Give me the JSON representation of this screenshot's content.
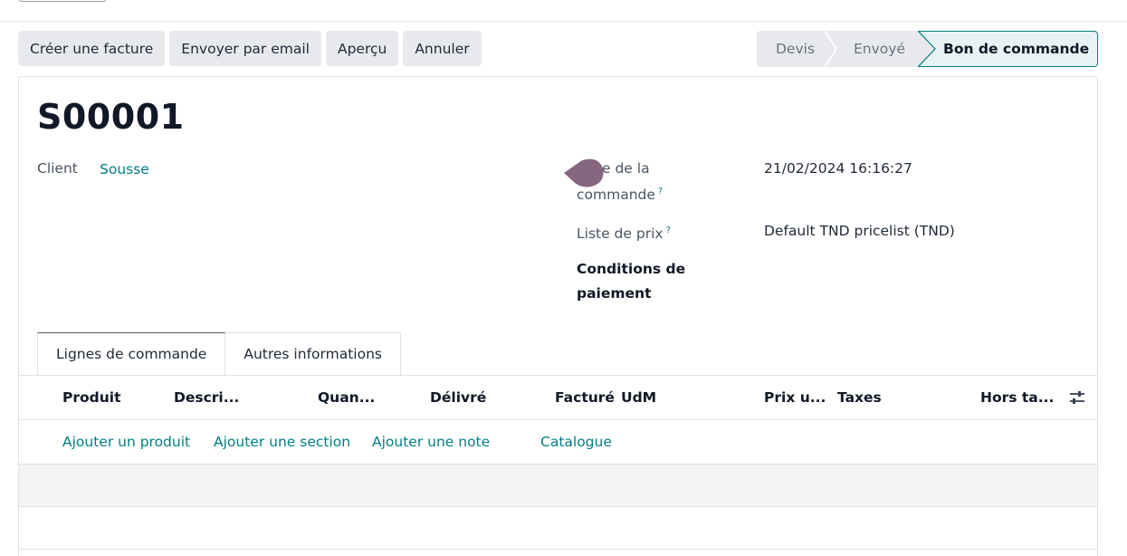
{
  "toolbar": {
    "create_invoice": "Créer une facture",
    "send_email": "Envoyer par email",
    "preview": "Aperçu",
    "cancel": "Annuler"
  },
  "statusbar": {
    "stages": [
      "Devis",
      "Envoyé",
      "Bon de commande"
    ],
    "active": "Bon de commande"
  },
  "record": {
    "name": "S00001",
    "client_label": "Client",
    "client_value": "Sousse",
    "order_date_label_line1": "e de la",
    "order_date_label_line2": "commande",
    "order_date_help": "?",
    "order_date_value": "21/02/2024 16:16:27",
    "pricelist_label": "Liste de prix",
    "pricelist_help": "?",
    "pricelist_value": "Default TND pricelist (TND)",
    "payment_terms_label_line1": "Conditions de",
    "payment_terms_label_line2": "paiement"
  },
  "tabs": {
    "order_lines": "Lignes de commande",
    "other_info": "Autres informations"
  },
  "table": {
    "columns": [
      "Produit",
      "Descri...",
      "Quan...",
      "Délivré",
      "Facturé",
      "UdM",
      "Prix u...",
      "Taxes",
      "Hors ta..."
    ]
  },
  "actions": {
    "add_product": "Ajouter un produit",
    "add_section": "Ajouter une section",
    "add_note": "Ajouter une note",
    "catalog": "Catalogue"
  },
  "colors": {
    "accent": "#017e84",
    "button_bg": "#e7e9ed",
    "cursor_blob": "#714b67"
  },
  "icons": {
    "column_options": "sliders-icon",
    "cursor": "cursor-blob-icon"
  }
}
